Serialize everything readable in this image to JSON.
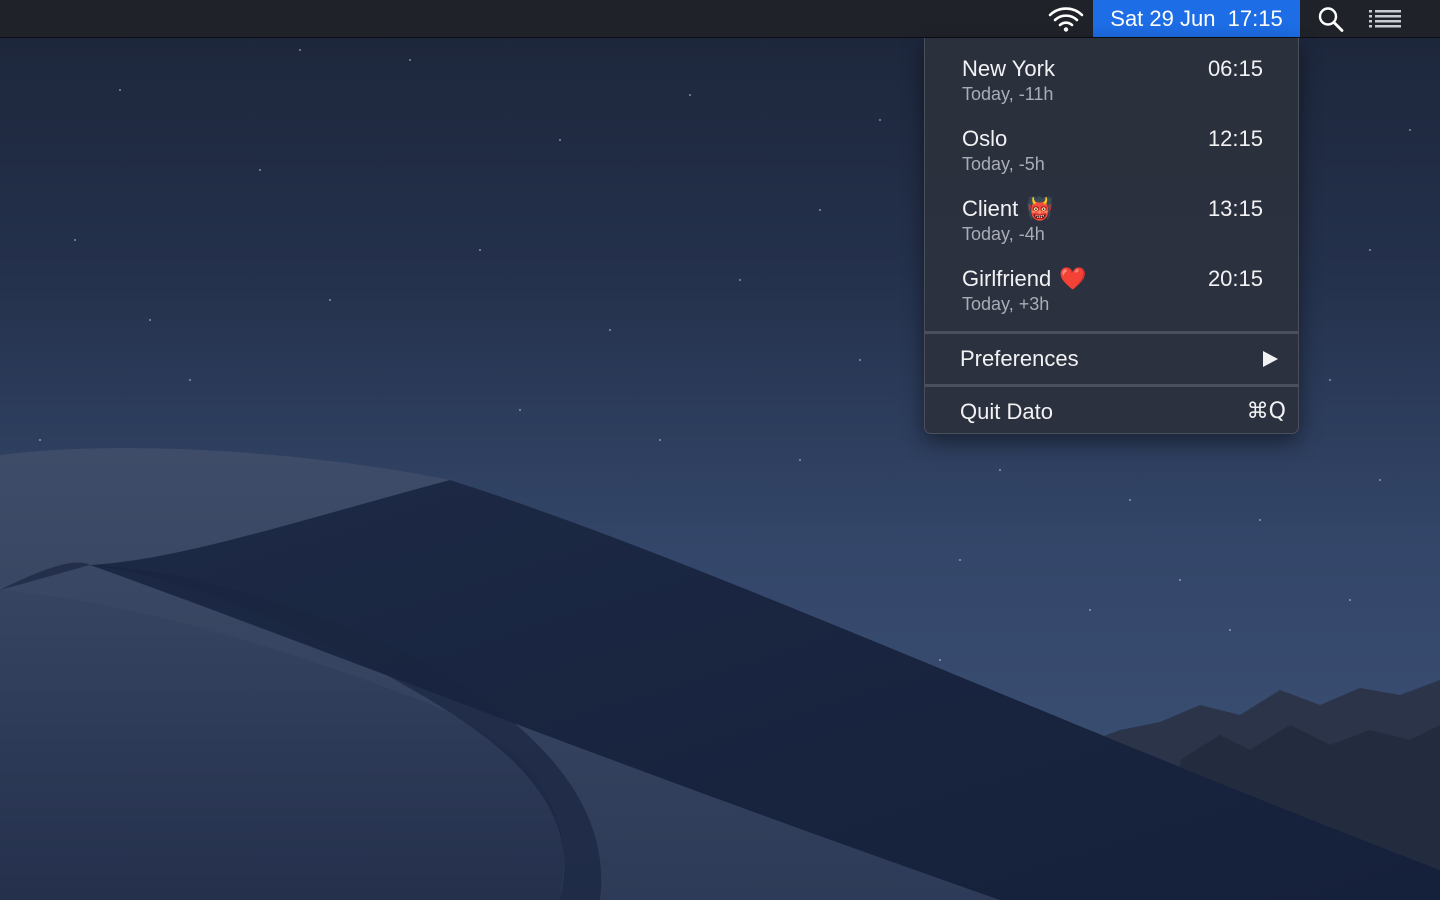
{
  "menubar": {
    "clock": "Sat 29 Jun  17:15",
    "icons": [
      "wifi-icon",
      "search-icon",
      "list-icon"
    ],
    "accent": "#1d6de6"
  },
  "menu": {
    "zones": [
      {
        "name": "New York",
        "emoji": "",
        "sub": "Today, -11h",
        "time": "06:15"
      },
      {
        "name": "Oslo",
        "emoji": "",
        "sub": "Today, -5h",
        "time": "12:15"
      },
      {
        "name": "Client",
        "emoji": "👹",
        "sub": "Today, -4h",
        "time": "13:15"
      },
      {
        "name": "Girlfriend",
        "emoji": "❤️",
        "sub": "Today, +3h",
        "time": "20:15"
      }
    ],
    "preferences_label": "Preferences",
    "quit_label": "Quit Dato",
    "quit_shortcut": "⌘Q"
  }
}
